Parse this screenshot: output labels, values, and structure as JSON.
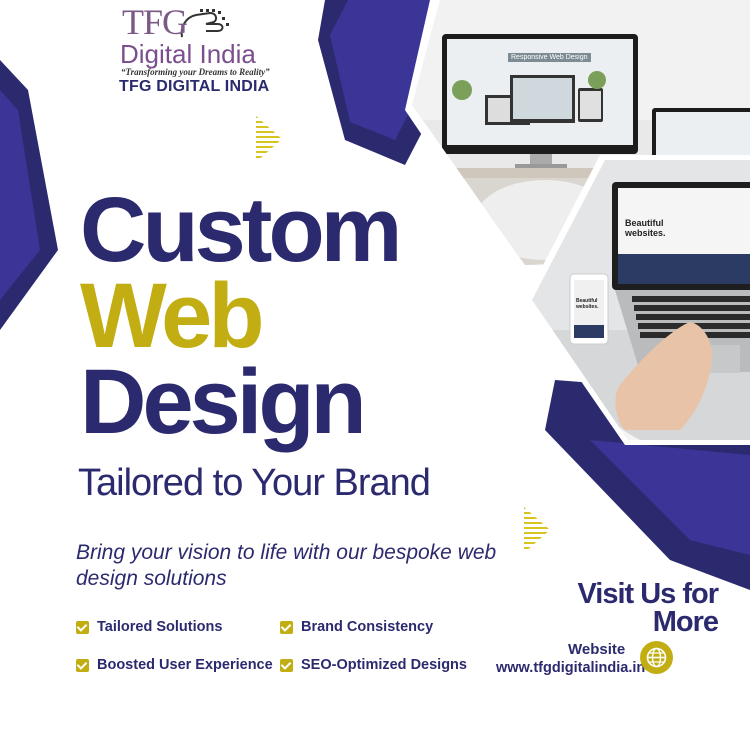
{
  "logo": {
    "mark": "TFG",
    "name": "Digital India",
    "tagline": "“Transforming your Dreams to Reality”"
  },
  "brand_name": "TFG DIGITAL INDIA",
  "headline": {
    "line1": "Custom",
    "line2": "Web",
    "line3": "Design"
  },
  "subheadline": "Tailored to Your Brand",
  "tagline": "Bring your vision to life with our bespoke web design solutions",
  "features": [
    "Tailored Solutions",
    "Brand Consistency",
    "Boosted User Experience",
    "SEO-Optimized Designs"
  ],
  "cta": {
    "line1": "Visit Us for",
    "line2": "More",
    "website_label": "Website",
    "website_url": "www.tfgdigitalindia.in"
  },
  "mockups": {
    "monitor_screen_title": "Responsive Web Design",
    "laptop_screen_title": "Beautiful websites.",
    "phone_screen_title": "Beautiful websites."
  },
  "colors": {
    "navy": "#2c2a6e",
    "indigo": "#3a3596",
    "gold": "#c2ad12",
    "purple": "#7a5a86"
  }
}
